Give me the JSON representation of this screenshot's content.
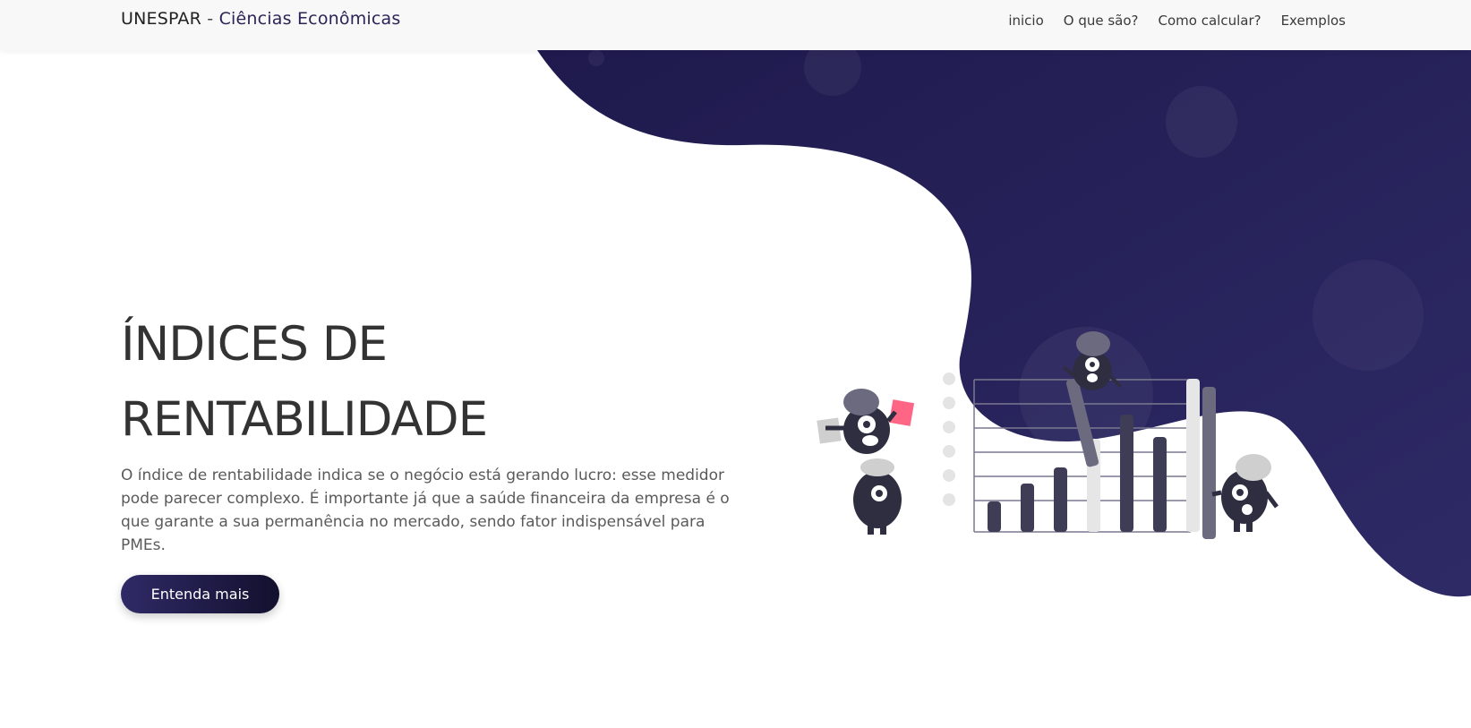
{
  "navbar": {
    "brand_org": "UNESPAR",
    "brand_separator": " - ",
    "brand_course": "Ciências Econômicas",
    "links": [
      {
        "label": "inicio"
      },
      {
        "label": "O que são?"
      },
      {
        "label": "Como calcular?"
      },
      {
        "label": "Exemplos"
      }
    ]
  },
  "hero": {
    "title_line1": "ÍNDICES DE",
    "title_line2": "RENTABILIDADE",
    "description": "O índice de rentabilidade indica se o negócio está gerando lucro: esse medidor pode parecer complexo. É importante já que a saúde financeira da empresa é o que garante a sua permanência no mercado, sendo fator indispensável para PMEs.",
    "cta_label": "Entenda mais"
  },
  "colors": {
    "accent_dark": "#2b2457",
    "blob": "#2a2459",
    "illustration_pink": "#ff6584",
    "illustration_dark": "#3f3d56"
  },
  "icons": {
    "hero_illustration": "monsters-bar-chart-illustration"
  }
}
